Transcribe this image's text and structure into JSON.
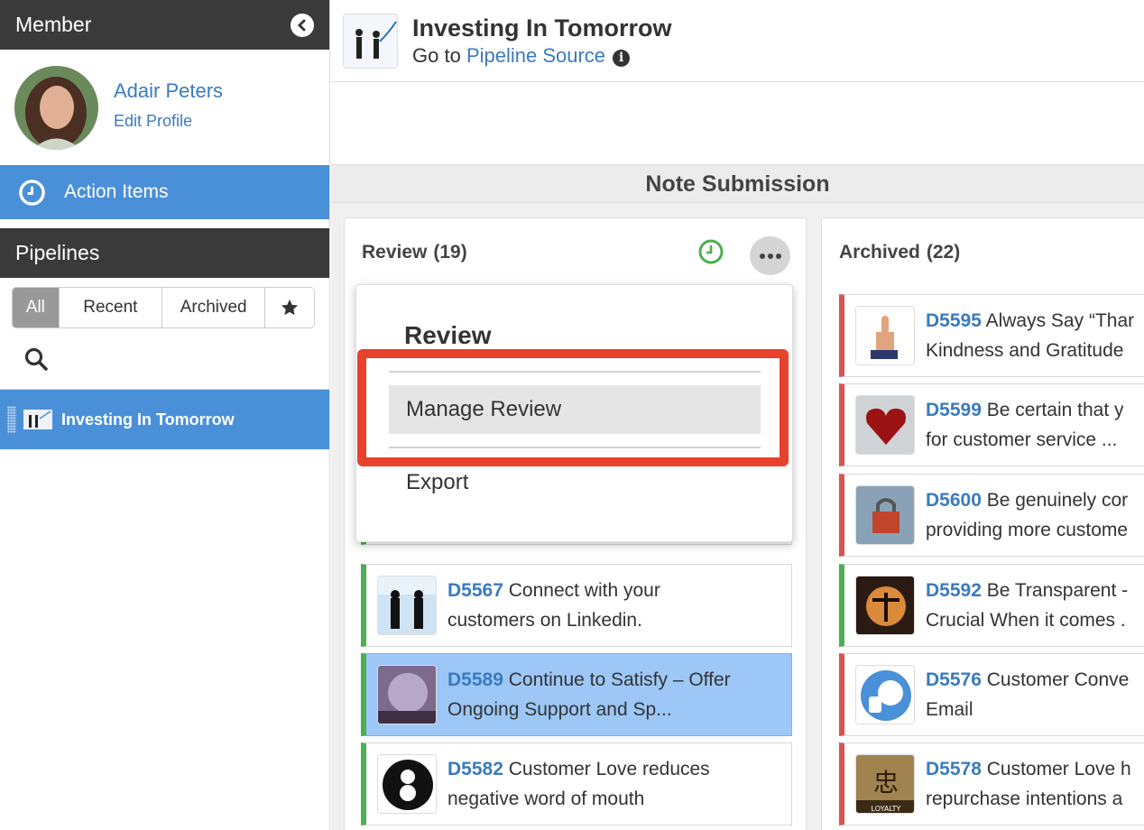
{
  "sidebar": {
    "member_title": "Member",
    "profile": {
      "name": "Adair Peters",
      "edit_label": "Edit Profile"
    },
    "action_items_label": "Action Items",
    "pipelines_title": "Pipelines",
    "filters": [
      "All",
      "Recent",
      "Archived"
    ],
    "active_filter": "All",
    "pipeline_items": [
      {
        "label": "Investing In Tomorrow"
      }
    ]
  },
  "header": {
    "title": "Investing In Tomorrow",
    "goto_prefix": "Go to",
    "goto_link": "Pipeline Source"
  },
  "stage": {
    "title": "Note Submission"
  },
  "columns": {
    "review": {
      "label": "Review",
      "count": "(19)"
    },
    "archived": {
      "label": "Archived",
      "count": "(22)"
    }
  },
  "dropdown": {
    "title": "Review",
    "items": [
      "Manage Review",
      "Export"
    ]
  },
  "review_cards": [
    {
      "code": "D5567",
      "line1": "Connect with your",
      "line2": "customers on Linkedin."
    },
    {
      "code": "D5589",
      "line1": "Continue to Satisfy – Offer",
      "line2": "Ongoing Support and Sp..."
    },
    {
      "code": "D5582",
      "line1": "Customer Love reduces",
      "line2": "negative word of mouth"
    }
  ],
  "archived_cards": [
    {
      "code": "D5595",
      "line1": "Always Say “Thar",
      "line2": "Kindness and Gratitude"
    },
    {
      "code": "D5599",
      "line1": "Be certain that y",
      "line2": "for customer service ..."
    },
    {
      "code": "D5600",
      "line1": "Be genuinely cor",
      "line2": "providing more custome"
    },
    {
      "code": "D5592",
      "line1": "Be Transparent -",
      "line2": "Crucial When it comes ."
    },
    {
      "code": "D5576",
      "line1": "Customer Conve",
      "line2": "Email"
    },
    {
      "code": "D5578",
      "line1": "Customer Love h",
      "line2": "repurchase intentions a"
    }
  ],
  "thumb_labels": {
    "loyalty": "LOYALTY"
  },
  "colors": {
    "sidebar_dark": "#3a3a3a",
    "accent_blue": "#4a90d9",
    "link_blue": "#3a7bbf",
    "status_green": "#4caf50",
    "status_red": "#d9534f",
    "highlight_red": "#e8412c",
    "selected_card": "#9cc7f7"
  }
}
